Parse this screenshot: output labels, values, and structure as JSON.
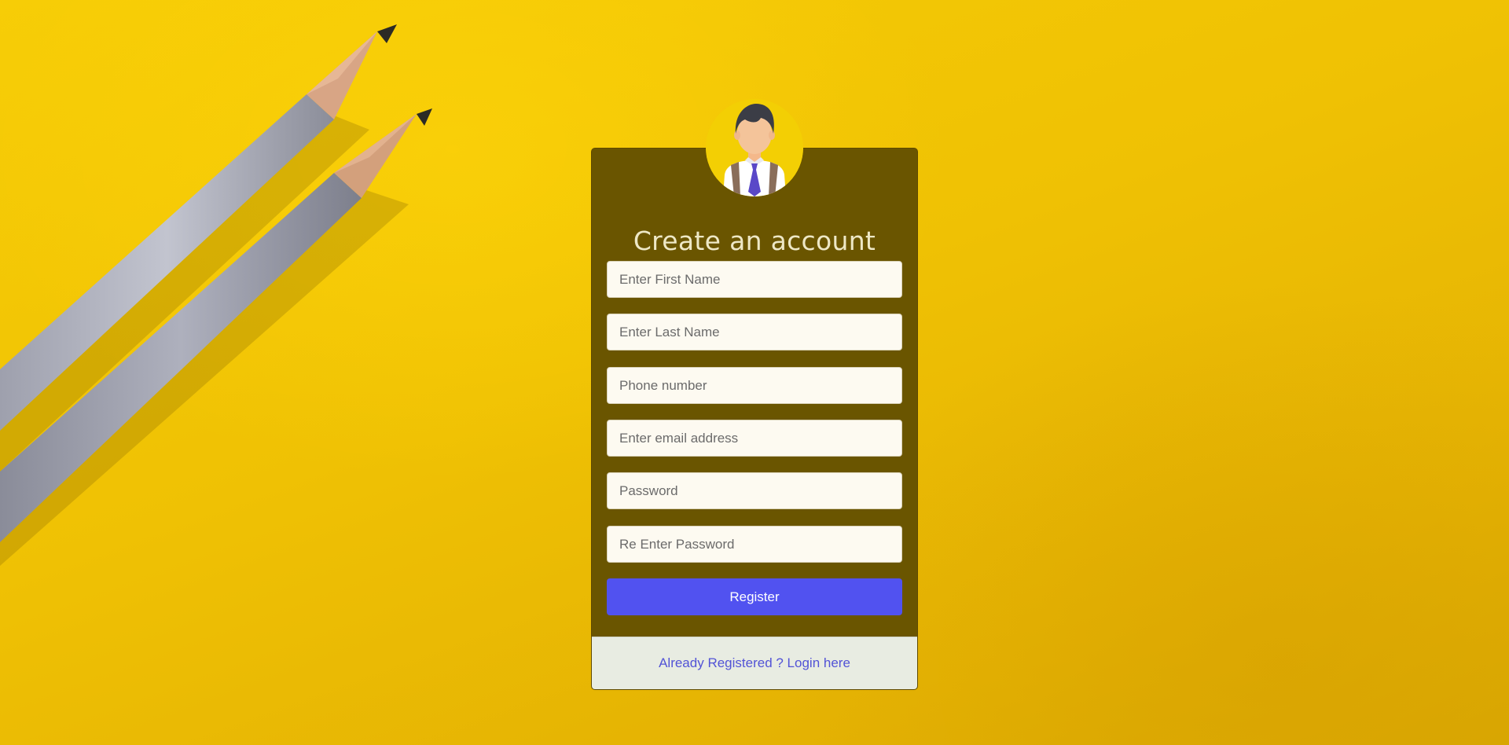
{
  "form": {
    "title": "Create an account",
    "fields": [
      {
        "placeholder": "Enter First Name"
      },
      {
        "placeholder": "Enter Last Name"
      },
      {
        "placeholder": "Phone number"
      },
      {
        "placeholder": "Enter email address"
      },
      {
        "placeholder": "Password"
      },
      {
        "placeholder": "Re Enter Password"
      }
    ],
    "register_label": "Register",
    "login_link": "Already Registered ? Login here"
  },
  "icons": {
    "avatar": "user-avatar-icon",
    "decoration": "pencils"
  },
  "colors": {
    "background": "#f2c505",
    "card": "#6a5500",
    "button": "#5152f0",
    "link": "#5253d6",
    "footer": "#e8ece2"
  }
}
